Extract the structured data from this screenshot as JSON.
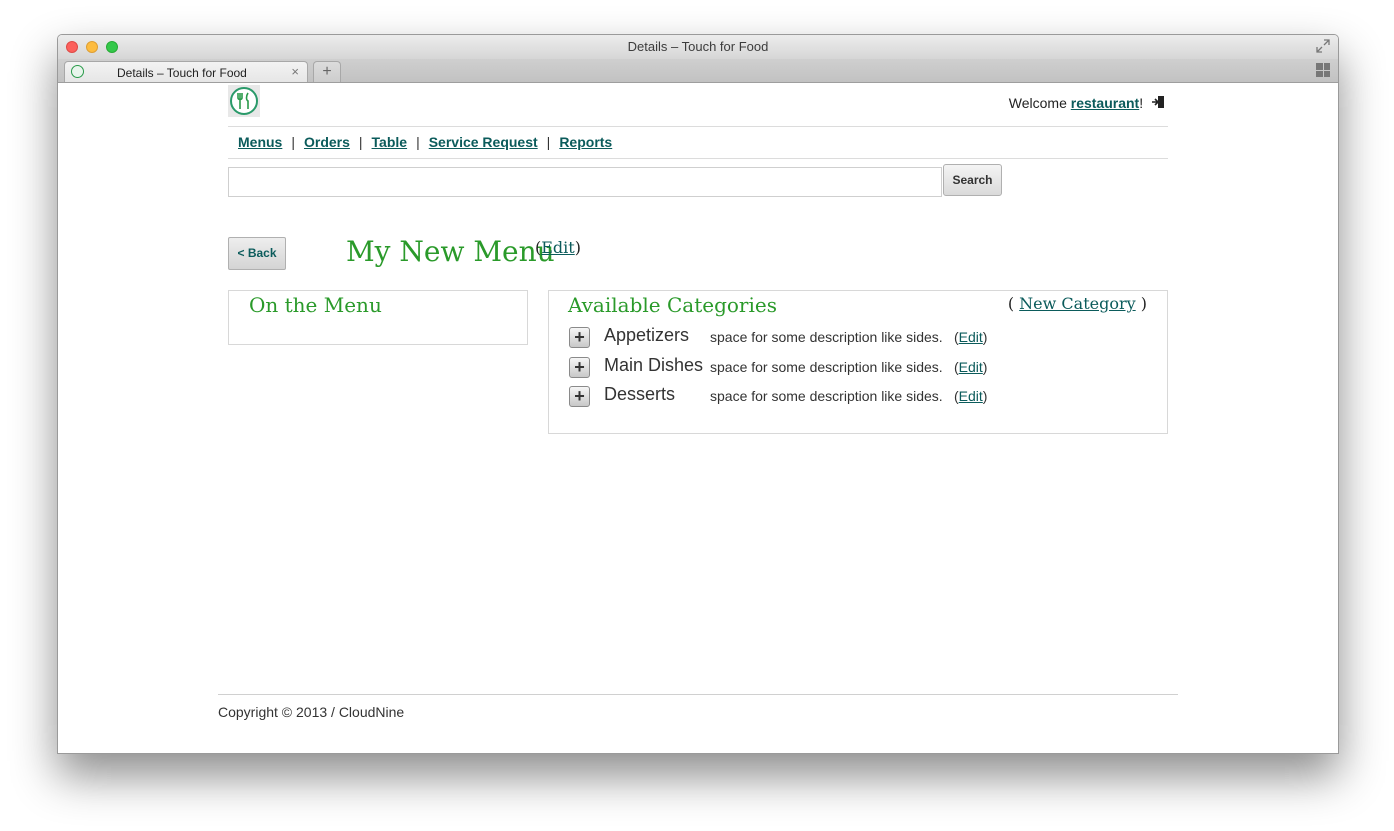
{
  "window": {
    "title": "Details – Touch for Food",
    "tab_title": "Details – Touch for Food",
    "tab_close": "×",
    "new_tab": "+"
  },
  "header": {
    "welcome_prefix": "Welcome ",
    "username": "restaurant",
    "welcome_suffix": "!"
  },
  "nav": {
    "items": [
      {
        "label": "Menus"
      },
      {
        "label": "Orders"
      },
      {
        "label": "Table"
      },
      {
        "label": "Service Request"
      },
      {
        "label": "Reports"
      }
    ],
    "separator": "|"
  },
  "search": {
    "value": "",
    "placeholder": "",
    "button_label": "Search"
  },
  "menu": {
    "back_label": "< Back",
    "title": "My New Menu",
    "edit_open": "(",
    "edit_label": "Edit",
    "edit_close": ")"
  },
  "on_menu": {
    "heading": "On the Menu"
  },
  "categories": {
    "heading": "Available Categories",
    "new_open": "( ",
    "new_label": "New Category",
    "new_close": " )",
    "items": [
      {
        "name": "Appetizers",
        "description": "space for some description like sides.",
        "edit_label": "Edit"
      },
      {
        "name": "Main Dishes",
        "description": "space for some description like sides.",
        "edit_label": "Edit"
      },
      {
        "name": "Desserts",
        "description": "space for some description like sides.",
        "edit_label": "Edit"
      }
    ]
  },
  "footer": {
    "copyright": "Copyright © 2013 / CloudNine"
  },
  "colors": {
    "accent_green": "#2a9a2a",
    "link_teal": "#0b5b5b"
  },
  "icons": {
    "logo": "fork-knife-logo-icon",
    "logout": "logout-icon",
    "add_category": "plus-icon"
  }
}
